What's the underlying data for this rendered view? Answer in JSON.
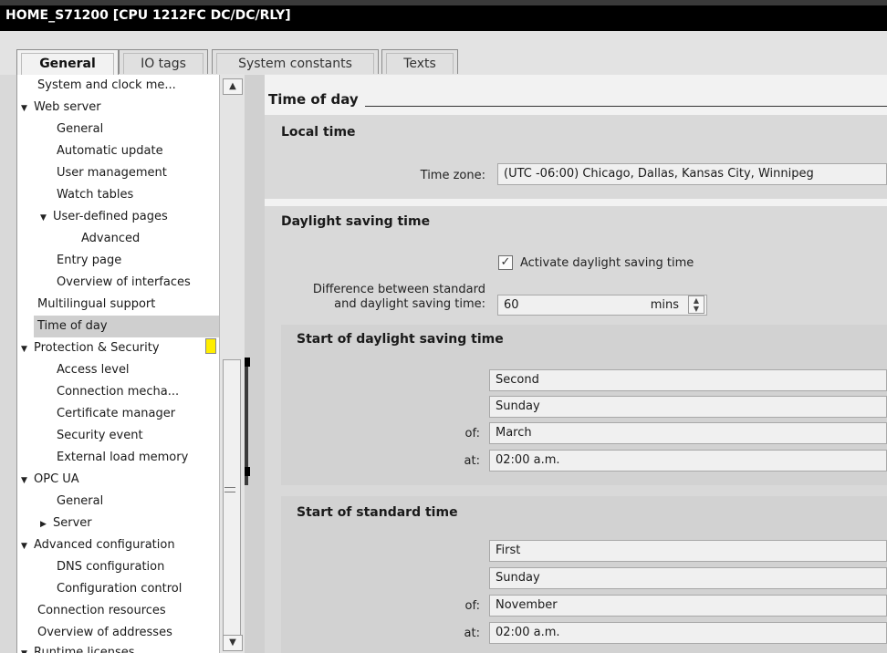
{
  "window": {
    "title": "HOME_S71200 [CPU 1212FC DC/DC/RLY]"
  },
  "tabs": [
    {
      "label": "General",
      "active": true
    },
    {
      "label": "IO tags",
      "active": false
    },
    {
      "label": "System constants",
      "active": false
    },
    {
      "label": "Texts",
      "active": false
    }
  ],
  "tree": {
    "items": [
      {
        "label": "System and clock me...",
        "expander": ""
      },
      {
        "label": "Web server",
        "expander": "▼"
      },
      {
        "label": "General",
        "expander": ""
      },
      {
        "label": "Automatic update",
        "expander": ""
      },
      {
        "label": "User management",
        "expander": ""
      },
      {
        "label": "Watch tables",
        "expander": ""
      },
      {
        "label": "User-defined pages",
        "expander": "▼"
      },
      {
        "label": "Advanced",
        "expander": ""
      },
      {
        "label": "Entry page",
        "expander": ""
      },
      {
        "label": "Overview of interfaces",
        "expander": ""
      },
      {
        "label": "Multilingual support",
        "expander": ""
      },
      {
        "label": "Time of day",
        "expander": ""
      },
      {
        "label": "Protection & Security",
        "expander": "▼"
      },
      {
        "label": "Access level",
        "expander": ""
      },
      {
        "label": "Connection mecha...",
        "expander": ""
      },
      {
        "label": "Certificate manager",
        "expander": ""
      },
      {
        "label": "Security event",
        "expander": ""
      },
      {
        "label": "External load memory",
        "expander": ""
      },
      {
        "label": "OPC UA",
        "expander": "▼"
      },
      {
        "label": "General",
        "expander": ""
      },
      {
        "label": "Server",
        "expander": "▶"
      },
      {
        "label": "Advanced configuration",
        "expander": "▼"
      },
      {
        "label": "DNS configuration",
        "expander": ""
      },
      {
        "label": "Configuration control",
        "expander": ""
      },
      {
        "label": "Connection resources",
        "expander": ""
      },
      {
        "label": "Overview of addresses",
        "expander": ""
      },
      {
        "label": "Runtime licenses",
        "expander": "▼"
      }
    ]
  },
  "content": {
    "heading": "Time of day",
    "local_time": {
      "title": "Local time",
      "time_zone_label": "Time zone:",
      "time_zone_value": "(UTC -06:00) Chicago, Dallas, Kansas City, Winnipeg"
    },
    "dst": {
      "title": "Daylight saving time",
      "activate_label": "Activate daylight saving time",
      "activate_checked": true,
      "checkmark": "✓",
      "difference_label_1": "Difference between standard",
      "difference_label_2": "and daylight saving time:",
      "difference_value": "60",
      "difference_unit": "mins",
      "spin_up": "▲",
      "spin_down": "▼"
    },
    "start_dst": {
      "title": "Start of daylight saving time",
      "week": "Second",
      "day": "Sunday",
      "of_label": "of:",
      "month": "March",
      "at_label": "at:",
      "time": "02:00 a.m."
    },
    "start_std": {
      "title": "Start of standard time",
      "week": "First",
      "day": "Sunday",
      "of_label": "of:",
      "month": "November",
      "at_label": "at:",
      "time": "02:00 a.m."
    }
  },
  "scrollbar": {
    "up_glyph": "▲",
    "down_glyph": "▼"
  },
  "colors": {
    "warning_marker": "#ffee00",
    "selected_bg": "#cfcfcf"
  }
}
